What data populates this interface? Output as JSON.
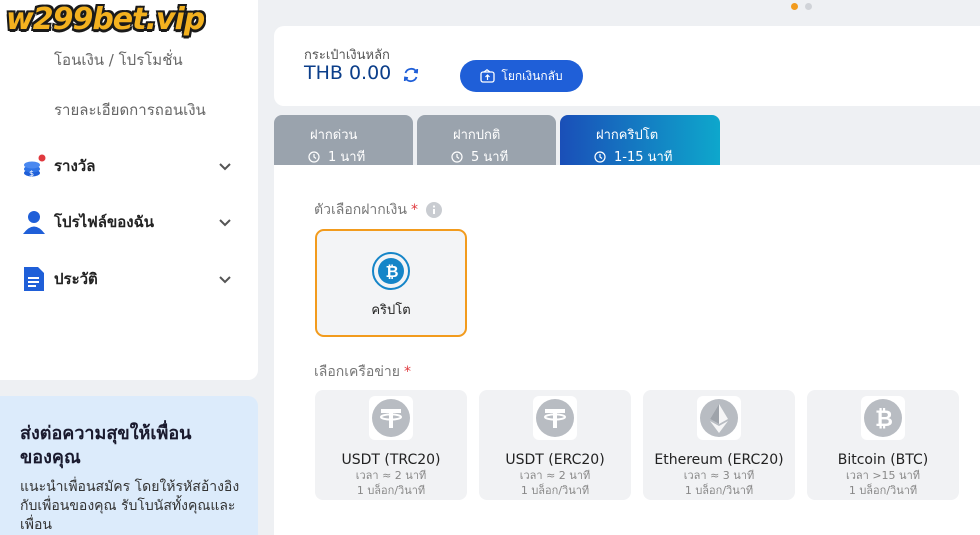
{
  "sidebar": {
    "logo": "w299bet.vip",
    "sub_links": [
      "โอนเงิน / โปรโมชั่น",
      "รายละเอียดการถอนเงิน"
    ],
    "menu": [
      {
        "label": "รางวัล",
        "icon": "reward-icon"
      },
      {
        "label": "โปรไฟล์ของฉัน",
        "icon": "profile-icon"
      },
      {
        "label": "ประวัติ",
        "icon": "history-icon"
      }
    ]
  },
  "promo": {
    "title": "ส่งต่อความสุขให้เพื่อนของคุณ",
    "text": "แนะนำเพื่อนสมัคร โดยให้รหัสอ้างอิงกับเพื่อนของคุณ รับโบนัสทั้งคุณและเพื่อน"
  },
  "wallet": {
    "label": "กระเป๋าเงินหลัก",
    "amount": "THB 0.00",
    "return_button": "โยกเงินกลับ"
  },
  "tabs": [
    {
      "label": "ฝากด่วน",
      "time": "1 นาที",
      "active": false
    },
    {
      "label": "ฝากปกติ",
      "time": "5 นาที",
      "active": false
    },
    {
      "label": "ฝากคริปโต",
      "time": "1-15 นาที",
      "active": true
    }
  ],
  "deposit": {
    "option_label": "ตัวเลือกฝากเงิน",
    "required_mark": "*",
    "option": "คริปโต",
    "network_label": "เลือกเครือข่าย"
  },
  "networks": [
    {
      "name": "USDT (TRC20)",
      "time": "เวลา ≈ 2 นาที",
      "blocks": "1 บล็อก/วินาที",
      "icon": "tether-icon"
    },
    {
      "name": "USDT (ERC20)",
      "time": "เวลา ≈ 2 นาที",
      "blocks": "1 บล็อก/วินาที",
      "icon": "tether-icon"
    },
    {
      "name": "Ethereum (ERC20)",
      "time": "เวลา ≈ 3 นาที",
      "blocks": "1 บล็อก/วินาที",
      "icon": "ethereum-icon"
    },
    {
      "name": "Bitcoin (BTC)",
      "time": "เวลา >15 นาที",
      "blocks": "1 บล็อก/วินาที",
      "icon": "bitcoin-icon"
    }
  ],
  "colors": {
    "accent_orange": "#f29b1d",
    "primary_blue": "#1f5fd8",
    "tab_grey": "#9aa3ad"
  }
}
